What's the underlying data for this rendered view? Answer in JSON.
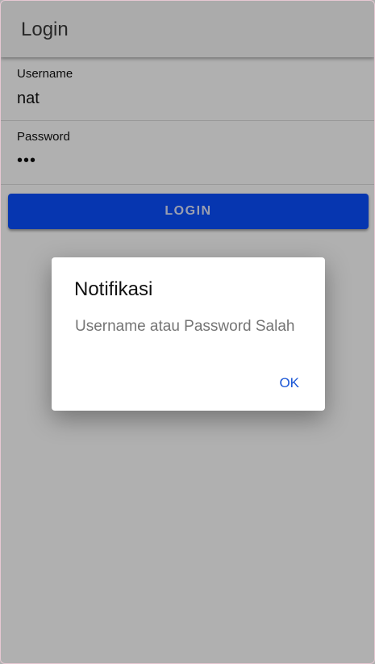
{
  "header": {
    "title": "Login"
  },
  "form": {
    "username_label": "Username",
    "username_value": "nat",
    "password_label": "Password",
    "password_value": "•••",
    "login_label": "LOGIN"
  },
  "dialog": {
    "title": "Notifikasi",
    "message": "Username atau Password Salah",
    "ok_label": "OK"
  },
  "colors": {
    "primary": "#0a4fff",
    "dialog_button": "#1a56d6"
  }
}
